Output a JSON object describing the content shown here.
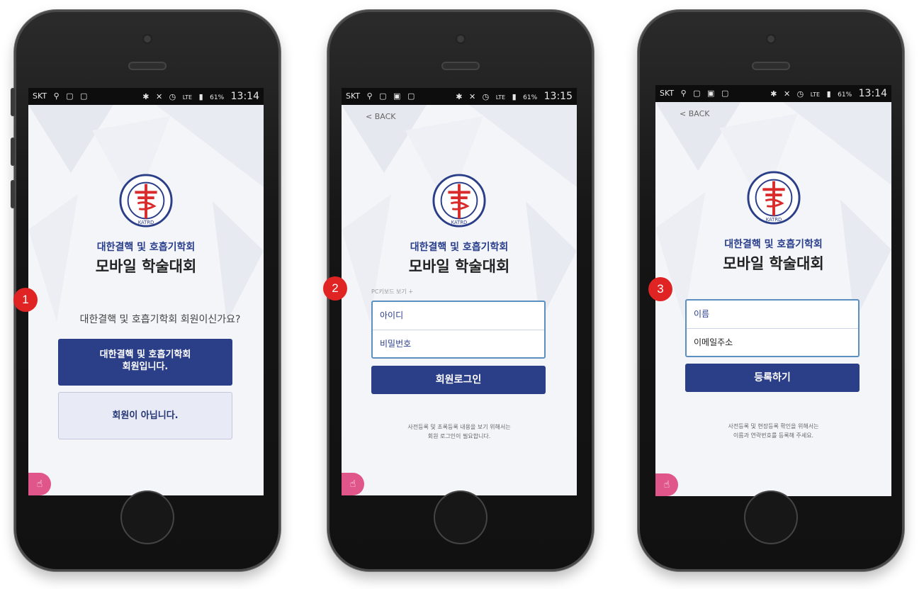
{
  "status": {
    "carrier": "SKT",
    "battery": "61%",
    "time_1": "13:14",
    "time_2": "13:15",
    "time_3": "13:14"
  },
  "common": {
    "org_name": "대한결핵 및 호흡기학회",
    "conf_name": "모바일 학술대회",
    "back_label": "< BACK",
    "logo_text": "KATRD"
  },
  "step1": {
    "badge": "1",
    "question": "대한결핵 및 호흡기학회 회원이신가요?",
    "member_btn_line1": "대한결핵 및 호흡기학회",
    "member_btn_line2": "회원입니다.",
    "nonmember_btn": "회원이 아닙니다."
  },
  "step2": {
    "badge": "2",
    "keyboard_toggle": "PC키보드 보기 ∔",
    "id_placeholder": "아이디",
    "pw_placeholder": "비밀번호",
    "login_btn": "회원로그인",
    "note_line1": "사전등록 및 초록등록 내용을 보기 위해서는",
    "note_line2": "회원 로그인이 필요합니다."
  },
  "step3": {
    "badge": "3",
    "name_placeholder": "이름",
    "email_placeholder": "이메일주소",
    "register_btn": "등록하기",
    "note_line1": "사전등록 및 현장등록 확인을 위해서는",
    "note_line2": "이름과 연락번호를 등록해 주세요."
  },
  "icons": {
    "touch": "touch-hand-icon",
    "bluetooth": "bluetooth-icon",
    "signal": "signal-icon",
    "alarm": "alarm-icon",
    "lte": "LTE"
  },
  "colors": {
    "primary": "#2b3f88",
    "badge": "#e02424",
    "touch": "#e0568b"
  }
}
